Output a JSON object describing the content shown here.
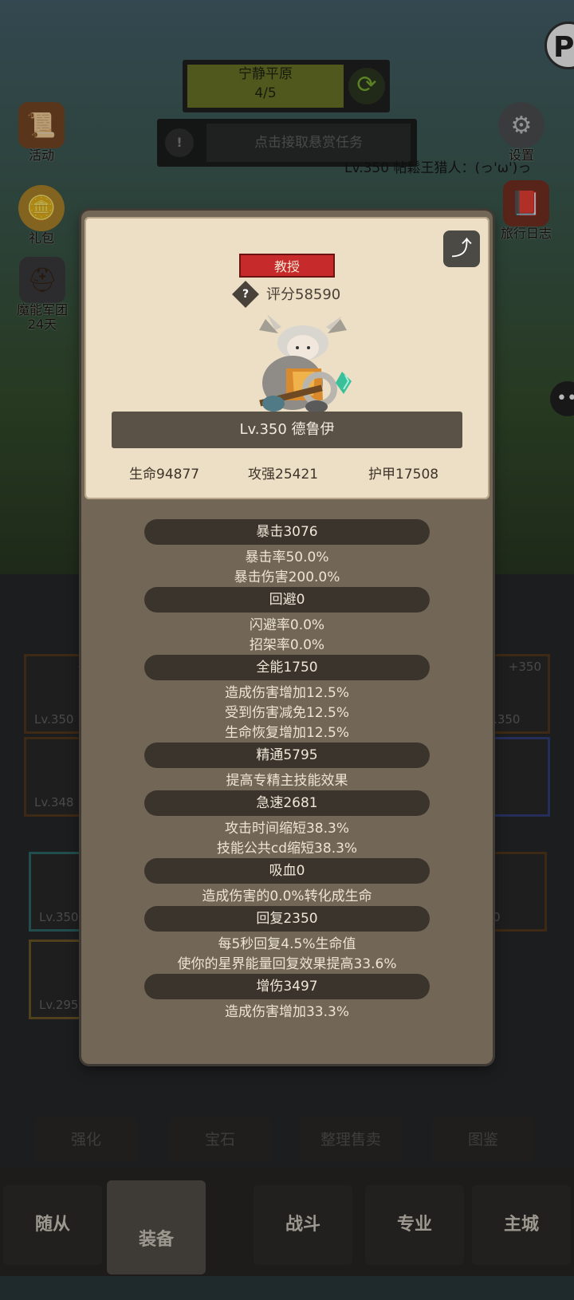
{
  "location": {
    "name": "宁静平原",
    "progress": "4/5"
  },
  "bounty": {
    "text": "点击接取悬赏任务",
    "alert_icon": "!"
  },
  "side_left": [
    {
      "label": "活动",
      "icon": "scroll-icon"
    },
    {
      "label": "礼包",
      "icon": "coin-chest-icon"
    },
    {
      "label": "魔能军团\n24天",
      "icon": "warrior-helmet-icon"
    }
  ],
  "side_right": [
    {
      "label": "设置",
      "icon": "gear-icon"
    },
    {
      "label": "旅行日志",
      "icon": "journal-icon"
    }
  ],
  "username": "Lv.350 帖鬆王猎人：(っ'ω')っ",
  "hero_card": {
    "title": "教授",
    "score": "评分58590",
    "name_level": "Lv.350 德鲁伊",
    "hp": "生命94877",
    "attack": "攻强25421",
    "armor": "护甲17508"
  },
  "stats": [
    {
      "header": "暴击3076",
      "lines": [
        "暴击率50.0%",
        "暴击伤害200.0%"
      ]
    },
    {
      "header": "回避0",
      "lines": [
        "闪避率0.0%",
        "招架率0.0%"
      ]
    },
    {
      "header": "全能1750",
      "lines": [
        "造成伤害增加12.5%",
        "受到伤害减免12.5%",
        "生命恢复增加12.5%"
      ]
    },
    {
      "header": "精通5795",
      "lines": [
        "提高专精主技能效果"
      ]
    },
    {
      "header": "急速2681",
      "lines": [
        "攻击时间缩短38.3%",
        "技能公共cd缩短38.3%"
      ]
    },
    {
      "header": "吸血0",
      "lines": [
        "造成伤害的0.0%转化成生命"
      ]
    },
    {
      "header": "回复2350",
      "lines": [
        "每5秒回复4.5%生命值",
        "使你的星界能量回复效果提高33.6%"
      ]
    },
    {
      "header": "增伤3497",
      "lines": [
        "造成伤害增加33.3%"
      ]
    }
  ],
  "slots": [
    {
      "level": "Lv.350",
      "plus": "+3"
    },
    {
      "level": "Lv.348",
      "plus": ""
    },
    {
      "level": "Lv.350",
      "plus": "+350"
    },
    {
      "level": "",
      "plus": ""
    },
    {
      "level": "Lv.350",
      "plus": ""
    },
    {
      "level": "Lv.295",
      "plus": ""
    },
    {
      "level": "350",
      "plus": ""
    }
  ],
  "tools": [
    "强化",
    "宝石",
    "整理售卖",
    "图鉴"
  ],
  "nav": [
    "随从",
    "装备",
    "战斗",
    "专业",
    "主城"
  ],
  "colors": {
    "badge": "#c72a2a",
    "panel": "#726756",
    "card": "#ecdfc5",
    "stat_bar": "#3b342d"
  }
}
